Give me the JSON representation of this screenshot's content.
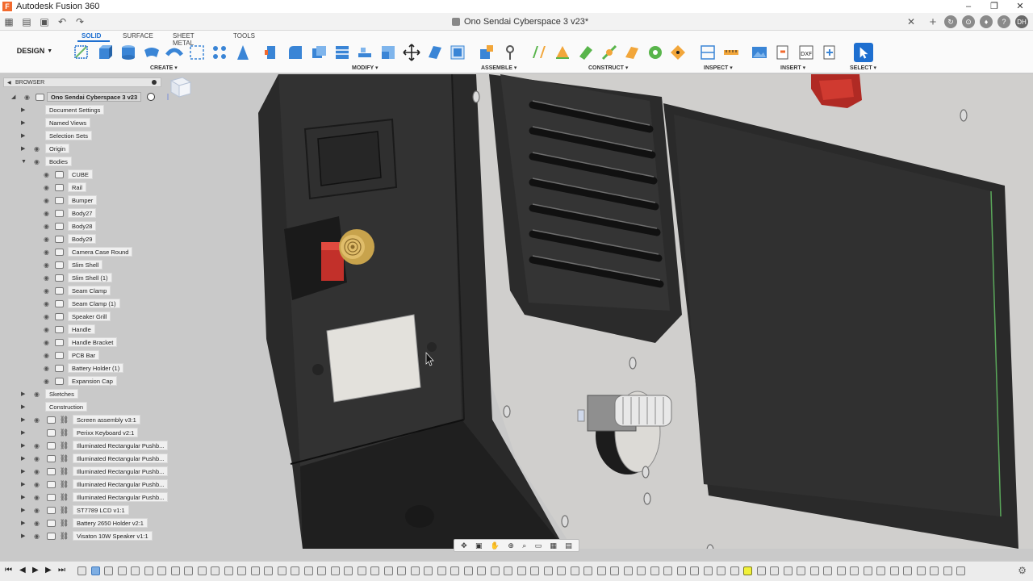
{
  "app": {
    "title": "Autodesk Fusion 360",
    "logo": "F"
  },
  "window_controls": {
    "minimize": "–",
    "restore": "❐",
    "close": "✕"
  },
  "document": {
    "tab_title": "Ono Sendai Cyberspace 3 v23*",
    "close_glyph": "✕"
  },
  "quick_access": {
    "grid": "grid-icon",
    "file": "file-icon",
    "save": "save-icon",
    "undo": "↶",
    "redo": "↷"
  },
  "user": {
    "initials": "DH"
  },
  "ribbon": {
    "workspace": "DESIGN",
    "tabs": [
      "SOLID",
      "SURFACE",
      "SHEET METAL",
      "TOOLS"
    ],
    "active_tab": "SOLID",
    "groups": [
      "CREATE ▾",
      "MODIFY ▾",
      "ASSEMBLE ▾",
      "CONSTRUCT ▾",
      "INSPECT ▾",
      "INSERT ▾",
      "SELECT ▾"
    ]
  },
  "browser": {
    "title": "BROWSER",
    "root": "Ono Sendai Cyberspace 3 v23",
    "items": [
      {
        "label": "Document Settings",
        "level": 1,
        "expander": "▶",
        "icon": "gear"
      },
      {
        "label": "Named Views",
        "level": 1,
        "expander": "▶",
        "icon": "folder"
      },
      {
        "label": "Selection Sets",
        "level": 1,
        "expander": "▶",
        "icon": "folder"
      },
      {
        "label": "Origin",
        "level": 1,
        "expander": "▶",
        "icon": "folder",
        "eye": true
      },
      {
        "label": "Bodies",
        "level": 1,
        "expander": "▼",
        "icon": "folder",
        "eye": true
      },
      {
        "label": "CUBE",
        "level": 2,
        "icon": "body",
        "eye": true
      },
      {
        "label": "Rail",
        "level": 2,
        "icon": "body",
        "eye": true
      },
      {
        "label": "Bumper",
        "level": 2,
        "icon": "body",
        "eye": true
      },
      {
        "label": "Body27",
        "level": 2,
        "icon": "body",
        "eye": true
      },
      {
        "label": "Body28",
        "level": 2,
        "icon": "body",
        "eye": true
      },
      {
        "label": "Body29",
        "level": 2,
        "icon": "body",
        "eye": true
      },
      {
        "label": "Camera Case Round",
        "level": 2,
        "icon": "body",
        "eye": true
      },
      {
        "label": "Slim Shell",
        "level": 2,
        "icon": "body",
        "eye": true
      },
      {
        "label": "Slim Shell (1)",
        "level": 2,
        "icon": "body",
        "eye": true
      },
      {
        "label": "Seam Clamp",
        "level": 2,
        "icon": "body",
        "eye": true
      },
      {
        "label": "Seam Clamp (1)",
        "level": 2,
        "icon": "body",
        "eye": true
      },
      {
        "label": "Speaker Grill",
        "level": 2,
        "icon": "body",
        "eye": true
      },
      {
        "label": "Handle",
        "level": 2,
        "icon": "body",
        "eye": true
      },
      {
        "label": "Handle Bracket",
        "level": 2,
        "icon": "body",
        "eye": true
      },
      {
        "label": "PCB Bar",
        "level": 2,
        "icon": "body",
        "eye": true
      },
      {
        "label": "Battery Holder (1)",
        "level": 2,
        "icon": "body",
        "eye": true
      },
      {
        "label": "Expansion Cap",
        "level": 2,
        "icon": "body",
        "eye": true
      },
      {
        "label": "Sketches",
        "level": 1,
        "expander": "▶",
        "icon": "folder",
        "eye": true
      },
      {
        "label": "Construction",
        "level": 1,
        "expander": "▶",
        "icon": "folder"
      },
      {
        "label": "Screen assembly v3:1",
        "level": 1,
        "expander": "▶",
        "icon": "link",
        "eye": true
      },
      {
        "label": "Perixx Keyboard v2:1",
        "level": 1,
        "expander": "▶",
        "icon": "link"
      },
      {
        "label": "Illuminated Rectangular Pushb...",
        "level": 1,
        "expander": "▶",
        "icon": "link",
        "eye": true
      },
      {
        "label": "Illuminated Rectangular Pushb...",
        "level": 1,
        "expander": "▶",
        "icon": "link",
        "eye": true
      },
      {
        "label": "Illuminated Rectangular Pushb...",
        "level": 1,
        "expander": "▶",
        "icon": "link",
        "eye": true
      },
      {
        "label": "Illuminated Rectangular Pushb...",
        "level": 1,
        "expander": "▶",
        "icon": "link",
        "eye": true
      },
      {
        "label": "Illuminated Rectangular Pushb...",
        "level": 1,
        "expander": "▶",
        "icon": "link",
        "eye": true
      },
      {
        "label": "ST7789 LCD v1:1",
        "level": 1,
        "expander": "▶",
        "icon": "link",
        "eye": true
      },
      {
        "label": "Battery 2650 Holder v2:1",
        "level": 1,
        "expander": "▶",
        "icon": "link",
        "eye": true
      },
      {
        "label": "Visaton 10W Speaker v1:1",
        "level": 1,
        "expander": "▶",
        "icon": "link",
        "eye": true
      }
    ]
  },
  "colors": {
    "accent": "#1e6fd0",
    "app_orange": "#f26a2e",
    "viewport_bg": "#c9c9c9",
    "highlight": "#f1f13a"
  },
  "nav_toolbar": [
    "✥",
    "▣",
    "✋",
    "⊕",
    "⌕",
    "▭",
    "▦",
    "▤"
  ],
  "timeline": {
    "controls": [
      "⏮",
      "◀",
      "▶",
      "▶",
      "⏭"
    ],
    "gear": "⚙"
  }
}
